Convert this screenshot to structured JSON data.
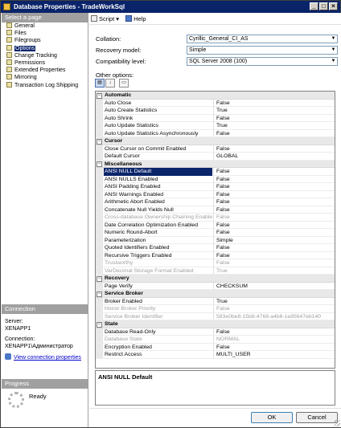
{
  "window": {
    "title": "Database Properties - TradeWorkSql"
  },
  "left_panel": {
    "select_page_header": "Select a page",
    "pages": [
      {
        "label": "General",
        "selected": false
      },
      {
        "label": "Files",
        "selected": false
      },
      {
        "label": "Filegroups",
        "selected": false
      },
      {
        "label": "Options",
        "selected": true
      },
      {
        "label": "Change Tracking",
        "selected": false
      },
      {
        "label": "Permissions",
        "selected": false
      },
      {
        "label": "Extended Properties",
        "selected": false
      },
      {
        "label": "Mirroring",
        "selected": false
      },
      {
        "label": "Transaction Log Shipping",
        "selected": false
      }
    ],
    "connection": {
      "header": "Connection",
      "server_label": "Server:",
      "server_value": "XENAPP1",
      "connection_label": "Connection:",
      "connection_value": "XENAPP1\\Администратор",
      "link": "View connection properties"
    },
    "progress": {
      "header": "Progress",
      "status": "Ready"
    }
  },
  "toolbar": {
    "script_label": "Script",
    "help_label": "Help"
  },
  "form": {
    "collation_label": "Collation:",
    "collation_value": "Cyrillic_General_CI_AS",
    "recovery_label": "Recovery model:",
    "recovery_value": "Simple",
    "compat_label": "Compatibility level:",
    "compat_value": "SQL Server 2008 (100)",
    "other_options_label": "Other options:"
  },
  "grid": {
    "categories": [
      {
        "name": "Automatic",
        "rows": [
          {
            "name": "Auto Close",
            "value": "False"
          },
          {
            "name": "Auto Create Statistics",
            "value": "True"
          },
          {
            "name": "Auto Shrink",
            "value": "False"
          },
          {
            "name": "Auto Update Statistics",
            "value": "True"
          },
          {
            "name": "Auto Update Statistics Asynchronously",
            "value": "False"
          }
        ]
      },
      {
        "name": "Cursor",
        "rows": [
          {
            "name": "Close Cursor on Commit Enabled",
            "value": "False"
          },
          {
            "name": "Default Cursor",
            "value": "GLOBAL"
          }
        ]
      },
      {
        "name": "Miscellaneous",
        "rows": [
          {
            "name": "ANSI NULL Default",
            "value": "False",
            "selected": true
          },
          {
            "name": "ANSI NULLS Enabled",
            "value": "False"
          },
          {
            "name": "ANSI Padding Enabled",
            "value": "False"
          },
          {
            "name": "ANSI Warnings Enabled",
            "value": "False"
          },
          {
            "name": "Arithmetic Abort Enabled",
            "value": "False"
          },
          {
            "name": "Concatenate Null Yields Null",
            "value": "False"
          },
          {
            "name": "Cross-database Ownership Chaining Enabled",
            "value": "False",
            "disabled": true
          },
          {
            "name": "Date Correlation Optimization Enabled",
            "value": "False"
          },
          {
            "name": "Numeric Round-Abort",
            "value": "False"
          },
          {
            "name": "Parameterization",
            "value": "Simple"
          },
          {
            "name": "Quoted Identifiers Enabled",
            "value": "False"
          },
          {
            "name": "Recursive Triggers Enabled",
            "value": "False"
          },
          {
            "name": "Trustworthy",
            "value": "False",
            "disabled": true
          },
          {
            "name": "VarDecimal Storage Format Enabled",
            "value": "True",
            "disabled": true
          }
        ]
      },
      {
        "name": "Recovery",
        "rows": [
          {
            "name": "Page Verify",
            "value": "CHECKSUM"
          }
        ]
      },
      {
        "name": "Service Broker",
        "rows": [
          {
            "name": "Broker Enabled",
            "value": "True"
          },
          {
            "name": "Honor Broker Priority",
            "value": "False",
            "disabled": true
          },
          {
            "name": "Service Broker Identifier",
            "value": "583e0be8-15b8-4768-a4b6-1e85647eb140",
            "disabled": true
          }
        ]
      },
      {
        "name": "State",
        "rows": [
          {
            "name": "Database Read-Only",
            "value": "False"
          },
          {
            "name": "Database State",
            "value": "NORMAL",
            "disabled": true
          },
          {
            "name": "Encryption Enabled",
            "value": "False"
          },
          {
            "name": "Restrict Access",
            "value": "MULTI_USER"
          }
        ]
      }
    ]
  },
  "description": {
    "title": "ANSI NULL Default"
  },
  "buttons": {
    "ok": "OK",
    "cancel": "Cancel"
  }
}
